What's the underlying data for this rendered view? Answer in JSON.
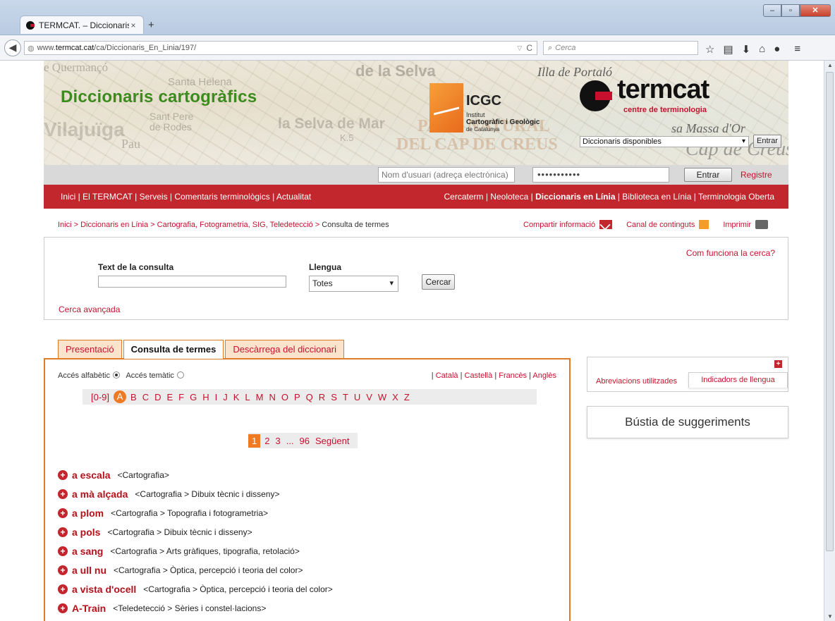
{
  "browser": {
    "tab_title": "TERMCAT. – Diccionaris ca...",
    "tab_close": "×",
    "new_tab": "+",
    "url_prefix": "www.",
    "url_domain": "termcat.cat",
    "url_path": "/ca/Diccionaris_En_Linia/197/",
    "search_placeholder": "Cerca",
    "win_min": "–",
    "win_max": "▫",
    "win_close": "✕"
  },
  "header": {
    "site_title": "Diccionaris cartogràfics",
    "icgc": {
      "name": "ICGC",
      "line1": "Institut",
      "line2": "Cartogràfic i Geològic",
      "line3": "de Catalunya"
    },
    "termcat": {
      "name": "termcat",
      "subtitle": "centre de terminologia"
    },
    "dic_select": "Diccionaris disponibles",
    "entrar_small": "Entrar",
    "map_words": [
      "e Quermançó",
      "de la Selva",
      "Illa de Portaló",
      "Santa Helena",
      "Vilajuïga",
      "Sant Pere de Rodes",
      "la Selva de Mar",
      "PARC NATURAL",
      "DEL CAP DE CREUS",
      "sa Massa d'Or",
      "Cap de Creus",
      "Pau",
      "K.5"
    ]
  },
  "login": {
    "user_placeholder": "Nom d'usuari (adreça electrònica)",
    "password_mask": "•••••••••••",
    "entrar": "Entrar",
    "registre": "Registre"
  },
  "menu": {
    "left": "Inici | El TERMCAT | Serveis | Comentaris terminològics | Actualitat",
    "right_a": "Cercaterm | Neoloteca | ",
    "right_b": "Diccionaris en Línia",
    "right_c": " | Biblioteca en Línia | Terminologia Oberta"
  },
  "breadcrumb": {
    "path": "Inici > Diccionaris en Línia > Cartografia, Fotogrametria, SIG, Teledetecció > ",
    "current": "Consulta de termes"
  },
  "share": {
    "compartir": "Compartir informació",
    "canal": "Canal de continguts",
    "imprimir": "Imprimir"
  },
  "search": {
    "help": "Com funciona la cerca?",
    "text_label": "Text de la consulta",
    "lang_label": "Llengua",
    "lang_value": "Totes",
    "button": "Cercar",
    "advanced": "Cerca avançada"
  },
  "tabs": [
    "Presentació",
    "Consulta de termes",
    "Descàrrega del diccionari"
  ],
  "access": {
    "alpha": "Accés alfabètic",
    "thematic": "Accés temàtic"
  },
  "langs": {
    "sep": "| ",
    "items": [
      "Català",
      "Castellà",
      "Francès",
      "Anglès"
    ]
  },
  "alphabet": {
    "first": "[0-9]",
    "active": "A",
    "letters": [
      "B",
      "C",
      "D",
      "E",
      "F",
      "G",
      "H",
      "I",
      "J",
      "K",
      "L",
      "M",
      "N",
      "O",
      "P",
      "Q",
      "R",
      "S",
      "T",
      "U",
      "V",
      "W",
      "X",
      "Z"
    ]
  },
  "pager": {
    "active": "1",
    "pages": [
      "2",
      "3",
      "...",
      "96",
      "Següent"
    ]
  },
  "terms": [
    {
      "term": "a escala",
      "domain": "<Cartografia>"
    },
    {
      "term": "a mà alçada",
      "domain": "<Cartografia > Dibuix tècnic i disseny>"
    },
    {
      "term": "a plom",
      "domain": "<Cartografia > Topografia i fotogrametria>"
    },
    {
      "term": "a pols",
      "domain": "<Cartografia > Dibuix tècnic i disseny>"
    },
    {
      "term": "a sang",
      "domain": "<Cartografia > Arts gràfiques, tipografia, retolació>"
    },
    {
      "term": "a ull nu",
      "domain": "<Cartografia > Òptica, percepció i teoria del color>"
    },
    {
      "term": "a vista d'ocell",
      "domain": "<Cartografia > Òptica, percepció i teoria del color>"
    },
    {
      "term": "A-Train",
      "domain": "<Teledetecció > Sèries i constel·lacions>"
    }
  ],
  "sidebar": {
    "plus": "+",
    "abrev": "Abreviacions utilitzades",
    "indicadors": "Indicadors de llengua",
    "bustia": "Bústia de suggeriments"
  },
  "colors": {
    "brand_red": "#c1272d",
    "tab_orange": "#e07b2a",
    "title_green": "#3c8b1e"
  }
}
